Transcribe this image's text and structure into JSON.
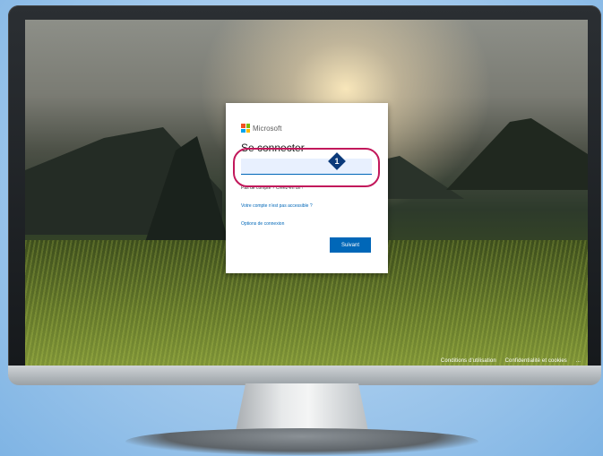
{
  "login": {
    "brand": "Microsoft",
    "title": "Se connecter",
    "input_value": "",
    "no_account_link": "Pas de compte ? Créez-en un !",
    "account_inaccessible_link": "Votre compte n'est pas accessible ?",
    "signin_options_link": "Options de connexion",
    "next_button": "Suivant"
  },
  "footer": {
    "terms": "Conditions d'utilisation",
    "privacy": "Confidentialité et cookies",
    "more": "..."
  },
  "annotation": {
    "step_number": "1"
  },
  "colors": {
    "accent": "#0067b8",
    "highlight": "#c2185b",
    "marker": "#0b3a7a",
    "ms_red": "#f25022",
    "ms_green": "#7fba00",
    "ms_blue": "#00a4ef",
    "ms_yellow": "#ffb900"
  }
}
